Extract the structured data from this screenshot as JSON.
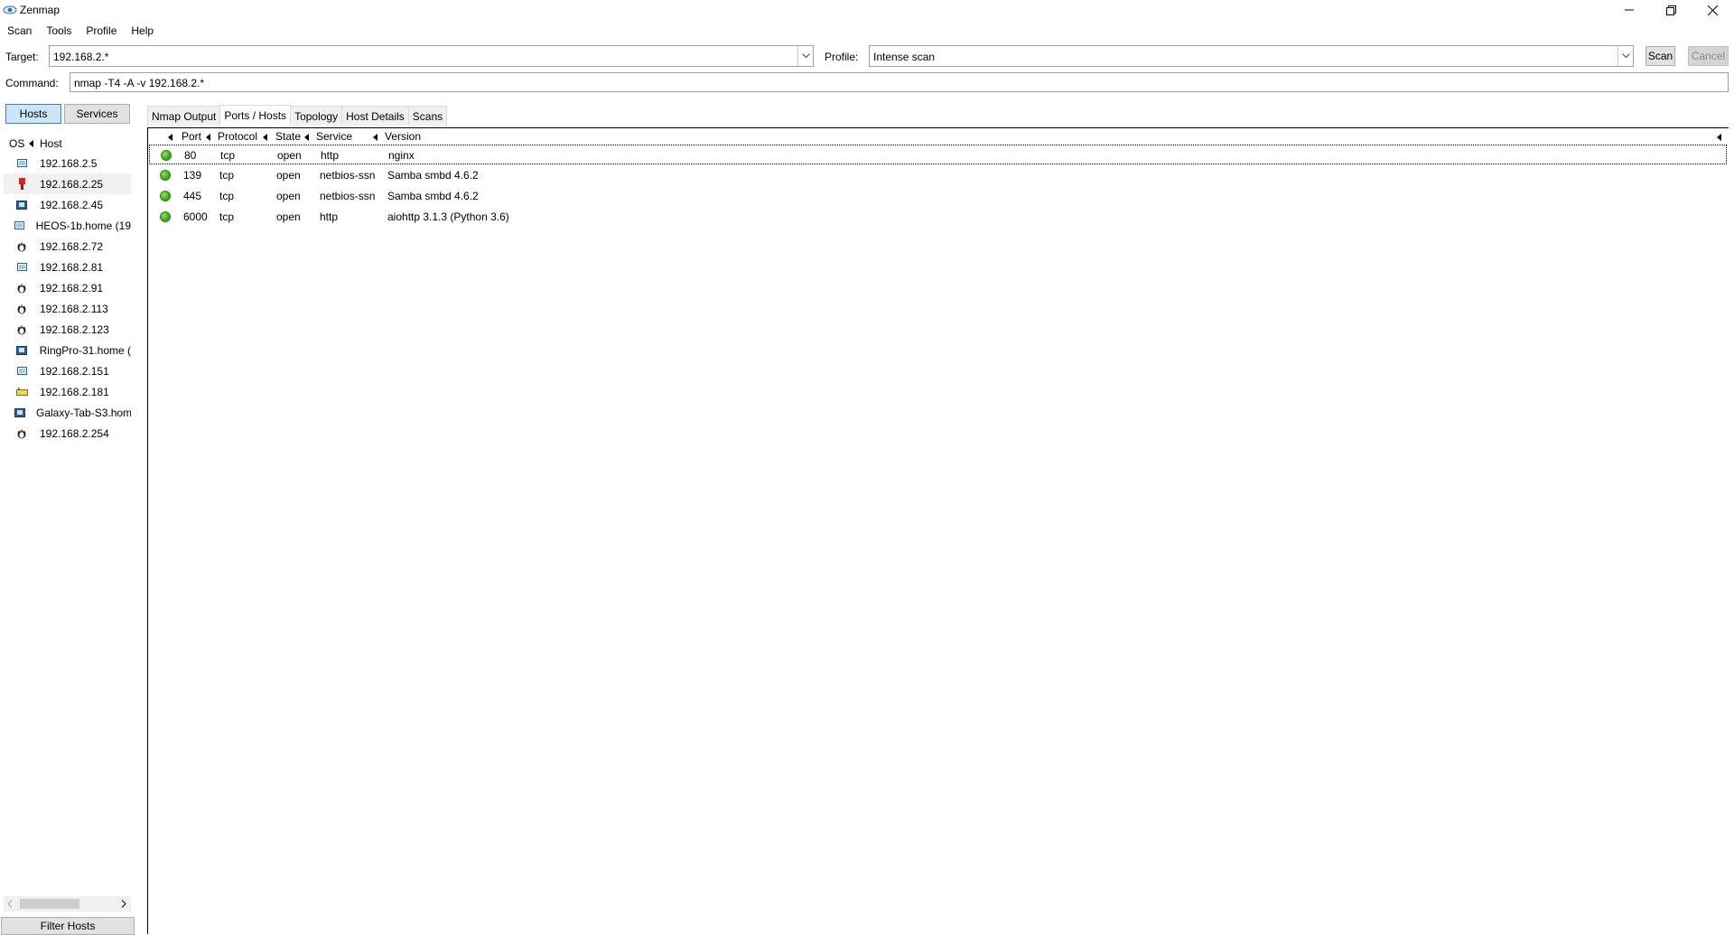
{
  "window": {
    "title": "Zenmap"
  },
  "menu": [
    "Scan",
    "Tools",
    "Profile",
    "Help"
  ],
  "toolbar": {
    "target_label": "Target:",
    "target_value": "192.168.2.*",
    "profile_label": "Profile:",
    "profile_value": "Intense scan",
    "scan_button": "Scan",
    "cancel_button": "Cancel",
    "command_label": "Command:",
    "command_value": "nmap -T4 -A -v 192.168.2.*"
  },
  "sidebar": {
    "hosts_button": "Hosts",
    "services_button": "Services",
    "columns": {
      "os": "OS",
      "host": "Host"
    },
    "hosts": [
      {
        "name": "192.168.2.5",
        "os_icon": "windows-icon"
      },
      {
        "name": "192.168.2.25",
        "os_icon": "unknown-red-icon",
        "selected": true
      },
      {
        "name": "192.168.2.45",
        "os_icon": "generic-device-icon"
      },
      {
        "name": "HEOS-1b.home (19",
        "os_icon": "windows-icon"
      },
      {
        "name": "192.168.2.72",
        "os_icon": "linux-icon"
      },
      {
        "name": "192.168.2.81",
        "os_icon": "windows-icon"
      },
      {
        "name": "192.168.2.91",
        "os_icon": "linux-icon"
      },
      {
        "name": "192.168.2.113",
        "os_icon": "linux-icon"
      },
      {
        "name": "192.168.2.123",
        "os_icon": "linux-icon"
      },
      {
        "name": "RingPro-31.home (",
        "os_icon": "generic-device-icon"
      },
      {
        "name": "192.168.2.151",
        "os_icon": "windows-icon"
      },
      {
        "name": "192.168.2.181",
        "os_icon": "router-icon"
      },
      {
        "name": "Galaxy-Tab-S3.hom",
        "os_icon": "generic-device-icon"
      },
      {
        "name": "192.168.2.254",
        "os_icon": "linux-icon"
      }
    ],
    "filter_button": "Filter Hosts"
  },
  "tabs": [
    "Nmap Output",
    "Ports / Hosts",
    "Topology",
    "Host Details",
    "Scans"
  ],
  "active_tab": "Ports / Hosts",
  "ports_table": {
    "columns": [
      "Port",
      "Protocol",
      "State",
      "Service",
      "Version"
    ],
    "rows": [
      {
        "port": "80",
        "protocol": "tcp",
        "state": "open",
        "service": "http",
        "version": "nginx"
      },
      {
        "port": "139",
        "protocol": "tcp",
        "state": "open",
        "service": "netbios-ssn",
        "version": "Samba smbd 4.6.2"
      },
      {
        "port": "445",
        "protocol": "tcp",
        "state": "open",
        "service": "netbios-ssn",
        "version": "Samba smbd 4.6.2"
      },
      {
        "port": "6000",
        "protocol": "tcp",
        "state": "open",
        "service": "http",
        "version": "aiohttp 3.1.3 (Python 3.6)"
      }
    ]
  },
  "colors": {
    "open_status": "#36a010",
    "selected_toggle": "#cce4f7"
  }
}
